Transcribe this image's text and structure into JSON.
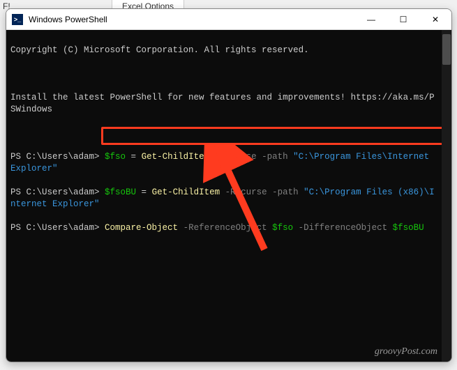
{
  "background": {
    "left_fragment": "F!",
    "tab_label": "Excel Options"
  },
  "window": {
    "title": "Windows PowerShell",
    "app_icon_glyph": ">_"
  },
  "controls": {
    "minimize": "―",
    "maximize": "☐",
    "close": "✕"
  },
  "terminal": {
    "copyright": "Copyright (C) Microsoft Corporation. All rights reserved.",
    "install_msg": "Install the latest PowerShell for new features and improvements! https://aka.ms/PSWindows",
    "lines": [
      {
        "prompt": "PS C:\\Users\\adam> ",
        "var": "$fso",
        "eq": " = ",
        "cmd": "Get-ChildItem",
        "param1": " -Recurse -path ",
        "path": "\"C:\\Program Files\\Internet Explorer\""
      },
      {
        "prompt": "PS C:\\Users\\adam> ",
        "var": "$fsoBU",
        "eq": " = ",
        "cmd": "Get-ChildItem",
        "param1": " -Recurse -path ",
        "path": "\"C:\\Program Files (x86)\\Internet Explorer\""
      },
      {
        "prompt": "PS C:\\Users\\adam> ",
        "cmd": "Compare-Object",
        "param1": " -ReferenceObject ",
        "var1": "$fso",
        "param2": " -DifferenceObject ",
        "var2": "$fsoBU"
      }
    ]
  },
  "watermark": "groovyPost.com"
}
